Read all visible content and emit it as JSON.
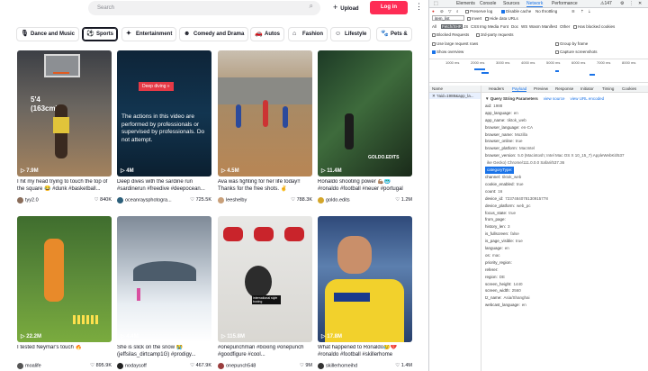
{
  "header": {
    "search_placeholder": "Search",
    "upload_label": "Upload",
    "login_label": "Log in"
  },
  "categories": [
    {
      "label": "Dance and Music",
      "icon": "microphone-icon",
      "active": false
    },
    {
      "label": "Sports",
      "icon": "ball-icon",
      "active": true
    },
    {
      "label": "Entertainment",
      "icon": "entertainment-icon",
      "active": false
    },
    {
      "label": "Comedy and Drama",
      "icon": "mask-icon",
      "active": false
    },
    {
      "label": "Autos",
      "icon": "car-icon",
      "active": false
    },
    {
      "label": "Fashion",
      "icon": "hanger-icon",
      "active": false
    },
    {
      "label": "Lifestyle",
      "icon": "lifestyle-icon",
      "active": false
    },
    {
      "label": "Pets &",
      "icon": "paw-icon",
      "active": false
    }
  ],
  "videos": [
    {
      "views": "7.9M",
      "caption": "I hit my head trying to touch the top of the square 😂 #dunk #basketball...",
      "user": "tyy2.0",
      "likes": "840K",
      "overlay": "5'4\n(163cm)"
    },
    {
      "views": "4M",
      "caption": "Deep dives with the sardine run #sardinerun #freedive #deepocean...",
      "user": "oceanraysphotogra...",
      "likes": "725.5K",
      "overlay": "The actions in this video are performed by professionals or supervised by professionals. Do not attempt.",
      "tag": "Deep diving »"
    },
    {
      "views": "4.5M",
      "caption": "Ava was fighting for her life today!! Thanks for the free shots. ✌️",
      "user": "leeshelby",
      "likes": "788.3K"
    },
    {
      "views": "11.4M",
      "caption": "Ronaldo shooting power 💪🏽🥶 #ronaldo #football #neuer #portugal",
      "user": "goldo.edits",
      "likes": "1.2M"
    },
    {
      "views": "22.2M",
      "caption": "I tested Neymar's touch 🔥",
      "user": "moalife",
      "likes": "895.9K"
    },
    {
      "views": "4.4M",
      "caption": "She is slick on the snow 😭 (jeffsilas_dirtcamp1G) #prodigy...",
      "user": "nodaysoff",
      "likes": "467.9K"
    },
    {
      "views": "115.8M",
      "caption": "#onepunchman #boxing #onepunch #goodfigure #cool...",
      "user": "onepunch548",
      "likes": "9M",
      "tag2": "international style boxing"
    },
    {
      "views": "17.8M",
      "caption": "What happened to Ronaldo😥💔 #ronaldo #football #skillerhome",
      "user": "skillerhomeihd",
      "likes": "1.4M"
    }
  ],
  "devtools": {
    "top_tabs": [
      "Elements",
      "Console",
      "Sources",
      "Network",
      "Performance",
      "Memory"
    ],
    "active_tab": "Network",
    "badge": "147",
    "toolbar": {
      "preserve_log": "Preserve log",
      "disable_cache": "Disable cache",
      "throttle": "No throttling"
    },
    "filter_value": "item_list",
    "filter_options": {
      "invert": "Invert",
      "hide_data": "Hide data URLs"
    },
    "types": [
      "All",
      "Fetch/XHR",
      "JS",
      "CSS",
      "Img",
      "Media",
      "Font",
      "Doc",
      "WS",
      "Wasm",
      "Manifest",
      "Other"
    ],
    "blocked_cookies": "Has blocked cookies",
    "blocked_requests": "Blocked Requests",
    "third_party": "3rd-party requests",
    "large_rows": "Use large request rows",
    "group_frame": "Group by frame",
    "overview": "Show overview",
    "screenshots": "Capture screenshots",
    "timeline_labels": [
      "1000 ms",
      "2000 ms",
      "3000 ms",
      "4000 ms",
      "5000 ms",
      "6000 ms",
      "7000 ms",
      "8000 ms"
    ],
    "req_header": "Name",
    "req_item": "?aid=1988&app_la...",
    "detail_tabs": [
      "Headers",
      "Payload",
      "Preview",
      "Response",
      "Initiator",
      "Timing",
      "Cookies"
    ],
    "detail_active": "Payload",
    "qs_title": "▼ Query String Parameters",
    "qs_view_source": "view source",
    "qs_view_url": "view URL encoded",
    "params": [
      {
        "k": "aid",
        "v": "1988"
      },
      {
        "k": "app_language",
        "v": "en"
      },
      {
        "k": "app_name",
        "v": "tiktok_web"
      },
      {
        "k": "browser_language",
        "v": "en-CA"
      },
      {
        "k": "browser_name",
        "v": "Mozilla"
      },
      {
        "k": "browser_online",
        "v": "true"
      },
      {
        "k": "browser_platform",
        "v": "MacIntel"
      },
      {
        "k": "browser_version",
        "v": "5.0 (Macintosh; Intel Mac OS X 10_15_7) AppleWebKit/537"
      },
      {
        "k": "",
        "v": "ike Gecko) Chrome/111.0.0.0 Safari/537.36"
      },
      {
        "k": "categoryType",
        "v": "",
        "hl": true
      },
      {
        "k": "channel",
        "v": "tiktok_web"
      },
      {
        "k": "cookie_enabled",
        "v": "true"
      },
      {
        "k": "count",
        "v": "16"
      },
      {
        "k": "device_id",
        "v": "7237484078130915778"
      },
      {
        "k": "device_platform",
        "v": "web_pc"
      },
      {
        "k": "focus_state",
        "v": "true"
      },
      {
        "k": "from_page",
        "v": ""
      },
      {
        "k": "history_len",
        "v": "3"
      },
      {
        "k": "is_fullscreen",
        "v": "false"
      },
      {
        "k": "is_page_visible",
        "v": "true"
      },
      {
        "k": "language",
        "v": "en"
      },
      {
        "k": "os",
        "v": "mac"
      },
      {
        "k": "priority_region",
        "v": ""
      },
      {
        "k": "referer",
        "v": ""
      },
      {
        "k": "region",
        "v": "DE"
      },
      {
        "k": "screen_height",
        "v": "1440"
      },
      {
        "k": "screen_width",
        "v": "2560"
      },
      {
        "k": "tz_name",
        "v": "Asia/Shanghai"
      },
      {
        "k": "webcast_language",
        "v": "en"
      }
    ]
  }
}
